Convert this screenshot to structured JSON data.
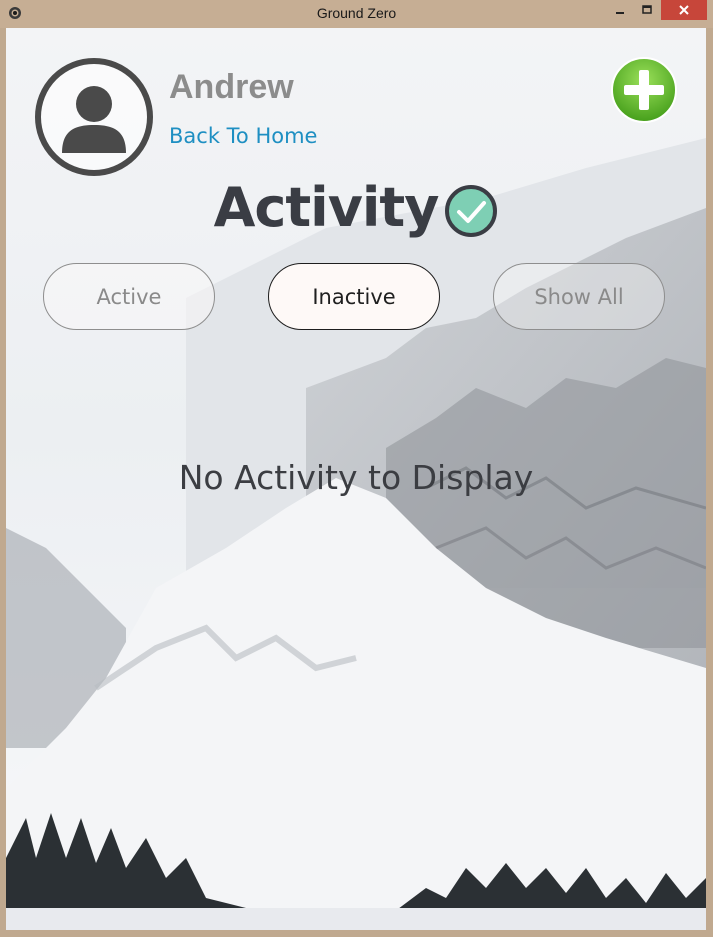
{
  "window": {
    "title": "Ground Zero",
    "icons": {
      "app": "app-eye-icon",
      "minimize": "minimize-icon",
      "maximize": "maximize-icon",
      "close": "close-icon"
    }
  },
  "profile": {
    "name": "Andrew",
    "back_link": "Back To Home",
    "avatar_icon": "user-avatar-icon",
    "add_icon": "plus-icon"
  },
  "page": {
    "heading": "Activity",
    "heading_icon": "checkmark-icon"
  },
  "filters": [
    {
      "label": "Active",
      "selected": false
    },
    {
      "label": "Inactive",
      "selected": true
    },
    {
      "label": "Show All",
      "selected": false
    }
  ],
  "empty_state": "No Activity to Display",
  "colors": {
    "link": "#1e8fc2",
    "heading": "#3a3d44",
    "add_button": "#6ab92a",
    "check": "#7ecfb4",
    "close_button": "#c7463a"
  }
}
